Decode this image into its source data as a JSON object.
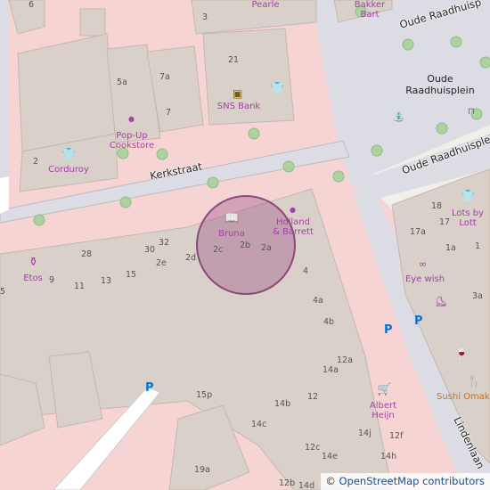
{
  "streets": {
    "kerkstraat": "Kerkstraat",
    "oude_raadhuisplein_top": "Oude Raadhuisp",
    "oude_raadhuisplein_right": "Oude Raadhuisplein",
    "lindenlaan": "Lindenlaan"
  },
  "places": {
    "square_line1": "Oude",
    "square_line2": "Raadhuisplein"
  },
  "pois": {
    "bakker_bart_line1": "Bakker",
    "bakker_bart_line2": "Bart",
    "pearle": "Pearle",
    "sns_bank": "SNS Bank",
    "popup_line1": "Pop-Up",
    "popup_line2": "Cookstore",
    "corduroy": "Corduroy",
    "bruna": "Bruna",
    "holland_line1": "Holland",
    "holland_line2": "& Barrett",
    "etos": "Etos",
    "lots_line1": "Lots by",
    "lots_line2": "Lott",
    "eye_wish": "Eye wish",
    "sushi": "Sushi Omak",
    "albert_line1": "Albert",
    "albert_line2": "Heijn"
  },
  "housenumbers": {
    "n6": "6",
    "n3": "3",
    "n21": "21",
    "n5a": "5a",
    "n7a": "7a",
    "n7": "7",
    "n2": "2",
    "n32": "32",
    "n28": "28",
    "n30": "30",
    "n2e": "2e",
    "n2d": "2d",
    "n2c": "2c",
    "n2b": "2b",
    "n2a": "2a",
    "n5": "5",
    "n9": "9",
    "n11": "11",
    "n13": "13",
    "n15": "15",
    "n4": "4",
    "n4a": "4a",
    "n4b": "4b",
    "n12a": "12a",
    "n14a": "14a",
    "n15p": "15p",
    "n14b": "14b",
    "n12": "12",
    "n14c": "14c",
    "n14j": "14j",
    "n12f": "12f",
    "n12c": "12c",
    "n14e": "14e",
    "n14h": "14h",
    "n19a": "19a",
    "n12b": "12b",
    "n14d": "14d",
    "n18": "18",
    "n17a": "17a",
    "n17": "17",
    "n1a": "1a",
    "n1": "1",
    "n3a": "3a"
  },
  "attribution": {
    "symbol": "©",
    "text": "OpenStreetMap contributors"
  },
  "colors": {
    "pedestrian_pink": "#f7d4d4",
    "building": "#d9d0c9",
    "square": "#dcdce4",
    "background": "#f2efe9",
    "poi_purple": "#a63fa6",
    "parking_blue": "#0077d4",
    "highlight_circle": "#9b4f85"
  }
}
